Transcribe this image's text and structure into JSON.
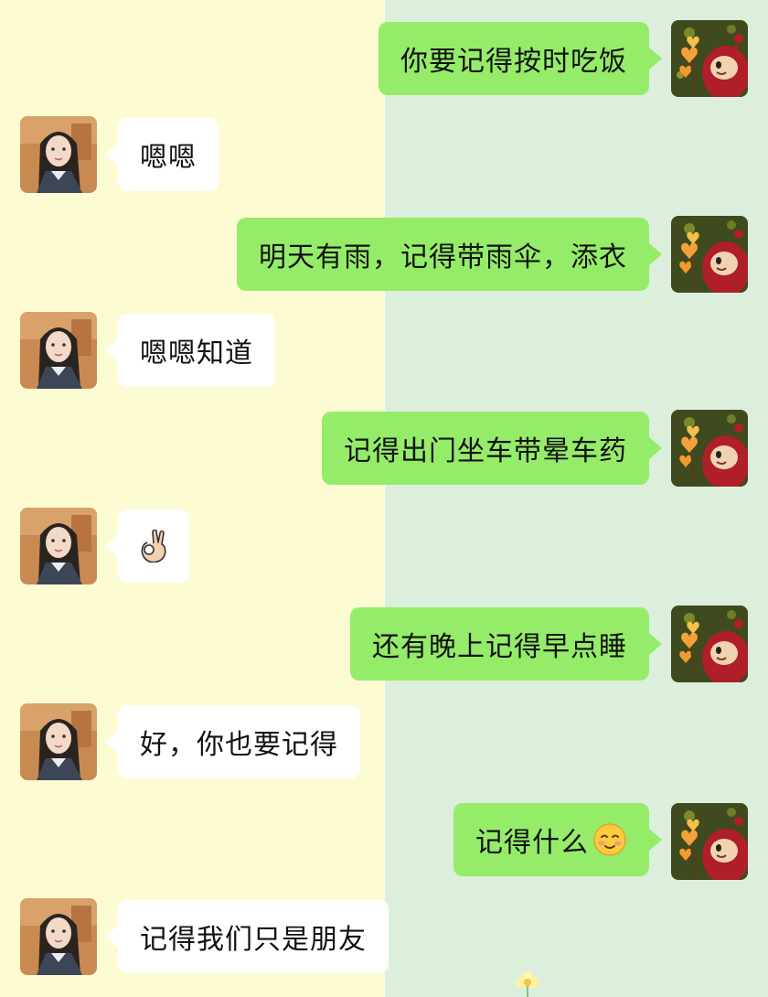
{
  "messages": [
    {
      "side": "me",
      "text": "你要记得按时吃饭"
    },
    {
      "side": "her",
      "text": "嗯嗯"
    },
    {
      "side": "me",
      "text": "明天有雨，记得带雨伞，添衣"
    },
    {
      "side": "her",
      "text": "嗯嗯知道"
    },
    {
      "side": "me",
      "text": "记得出门坐车带晕车药"
    },
    {
      "side": "her",
      "text": "",
      "emoji": "ok-hand-emoji"
    },
    {
      "side": "me",
      "text": "还有晚上记得早点睡"
    },
    {
      "side": "her",
      "text": "好，你也要记得"
    },
    {
      "side": "me",
      "text": "记得什么",
      "emoji": "smiling-face-emoji"
    },
    {
      "side": "her",
      "text": "记得我们只是朋友"
    }
  ],
  "colors": {
    "left_background": "#fdfbd2",
    "right_background": "#dcefdc",
    "my_bubble": "#95ec69",
    "her_bubble": "#ffffff"
  },
  "avatars": {
    "me": "teletubby-po-avatar",
    "her": "girl-portrait-avatar"
  }
}
